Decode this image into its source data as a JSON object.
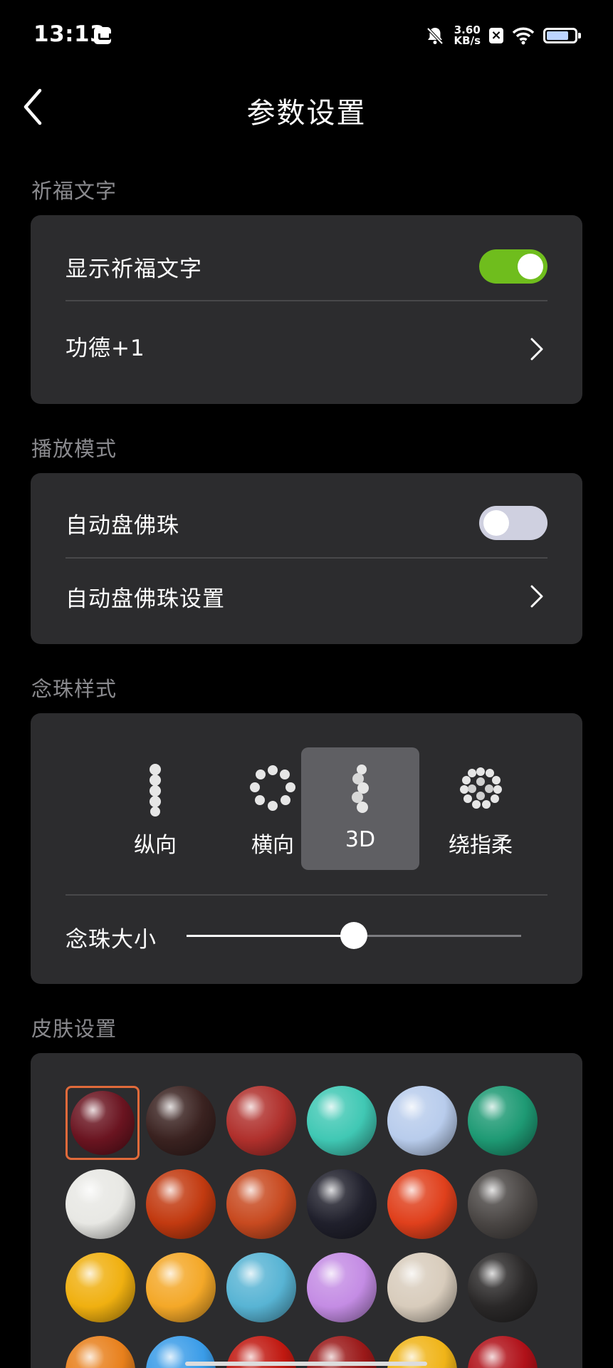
{
  "status_bar": {
    "time": "13:13",
    "net_speed_value": "3.60",
    "net_speed_unit": "KB/s",
    "icons": [
      "app-notification-icon",
      "bell-muted-icon",
      "sim-x-icon",
      "wifi-icon",
      "battery-icon"
    ]
  },
  "header": {
    "title": "参数设置",
    "back_icon": "chevron-left-icon"
  },
  "sections": {
    "prayer_text": {
      "label": "祈福文字",
      "show_label": "显示祈福文字",
      "show_enabled": true,
      "merit_label": "功德+1"
    },
    "play_mode": {
      "label": "播放模式",
      "auto_label": "自动盘佛珠",
      "auto_enabled": false,
      "auto_settings_label": "自动盘佛珠设置"
    },
    "bead_style": {
      "label": "念珠样式",
      "options": [
        "纵向",
        "横向",
        "3D",
        "绕指柔"
      ],
      "selected": "3D",
      "size_label": "念珠大小",
      "size_value": 0.5
    },
    "skin": {
      "label": "皮肤设置",
      "selected_index": 0,
      "colors": [
        "#6a1420",
        "#3a2220",
        "#b0302c",
        "#40c8b4",
        "#b8ccec",
        "#1e9a74",
        "#e8e8e4",
        "#c23a10",
        "#c84a20",
        "#20202c",
        "#e0401c",
        "#4a4644",
        "#f0b010",
        "#f4a828",
        "#58b4d4",
        "#c48ce4",
        "#d8ccbc",
        "#2a2828",
        "#e8801c",
        "#3a9ce8",
        "#c01810",
        "#9a1818",
        "#f0b418",
        "#b01018"
      ]
    }
  },
  "theme": {
    "background": "#000000",
    "card": "#2c2c2e",
    "toggle_on": "#6fbd1d",
    "toggle_off": "#cfd0e0",
    "selected_border": "#e06a3a"
  }
}
